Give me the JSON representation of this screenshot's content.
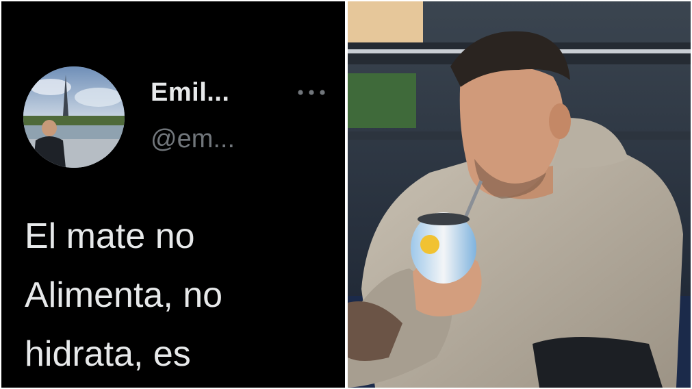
{
  "tweet": {
    "display_name": "Emil...",
    "handle": "@em...",
    "text": "El mate no\nAlimenta, no\nhidrata, es",
    "more_icon": "more-horizontal-icon"
  },
  "colors": {
    "panel_bg": "#000000",
    "primary_text": "#e7e9ea",
    "secondary_text": "#71767b"
  }
}
